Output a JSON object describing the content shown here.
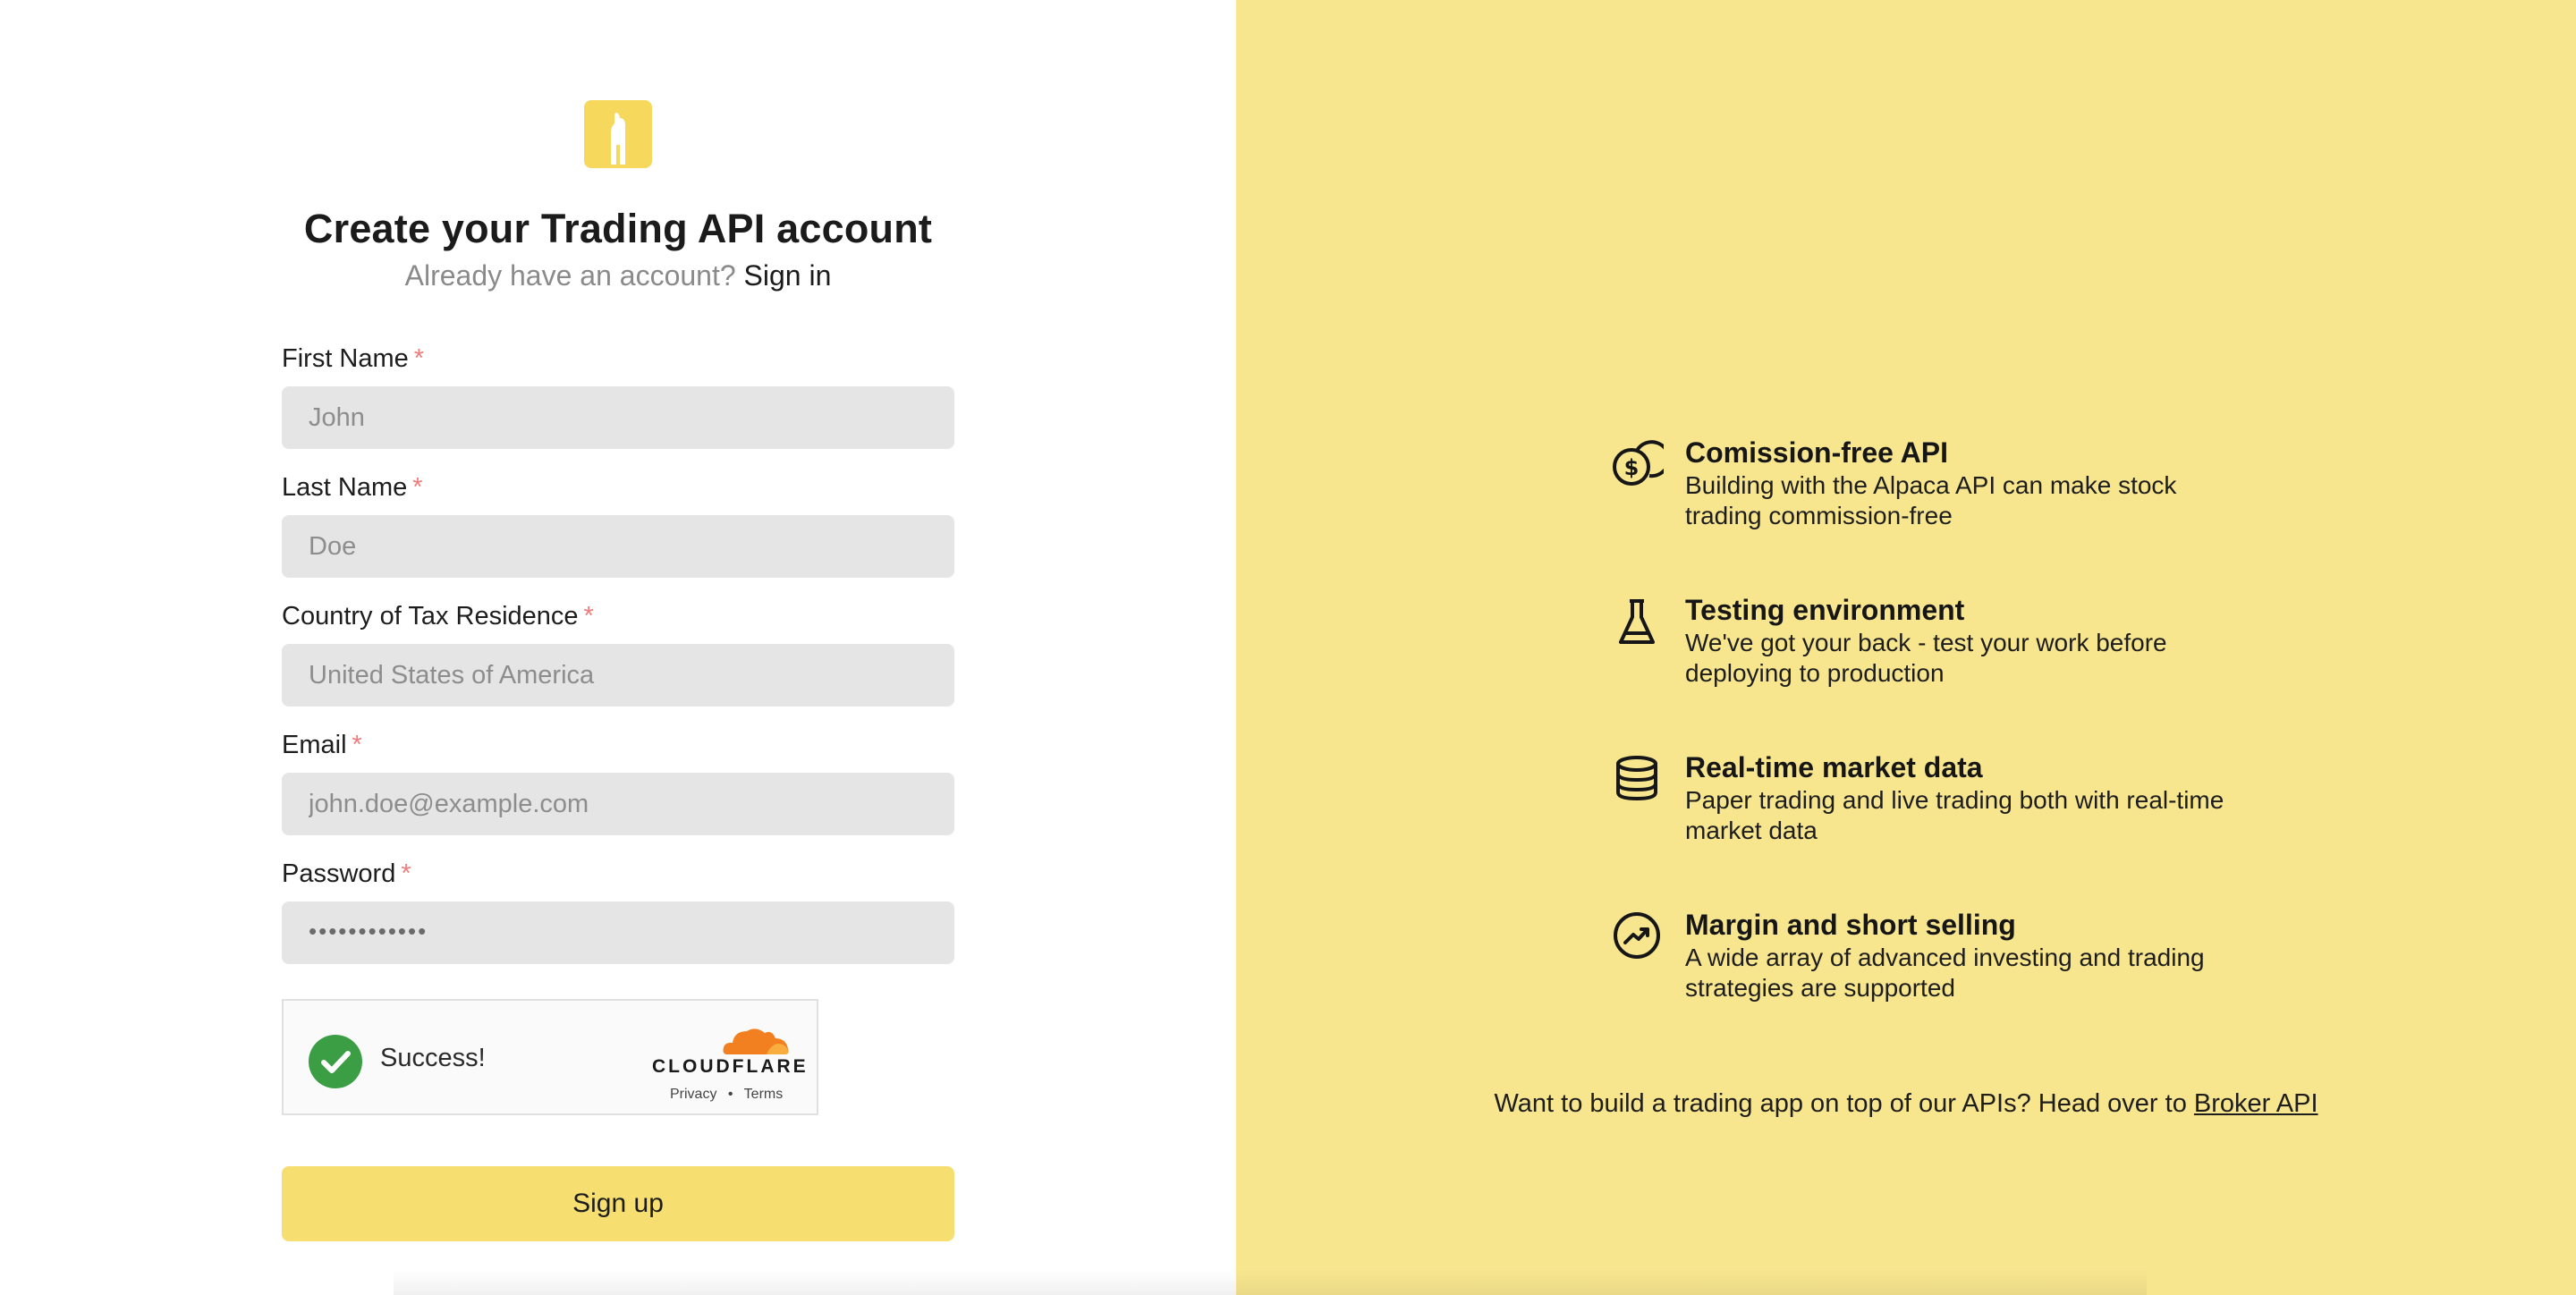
{
  "header": {
    "title": "Create your Trading API account",
    "subtitle_prefix": "Already have an account?",
    "signin_link": "Sign in"
  },
  "form": {
    "required_mark": "*",
    "fields": {
      "first_name": {
        "label": "First Name",
        "placeholder": "John"
      },
      "last_name": {
        "label": "Last Name",
        "placeholder": "Doe"
      },
      "country": {
        "label": "Country of Tax Residence",
        "placeholder": "United States of America"
      },
      "email": {
        "label": "Email",
        "placeholder": "john.doe@example.com"
      },
      "password": {
        "label": "Password",
        "masked_value": "••••••••••••"
      }
    },
    "captcha": {
      "status_text": "Success!",
      "brand": "CLOUDFLARE",
      "privacy": "Privacy",
      "separator": "•",
      "terms": "Terms"
    },
    "submit_label": "Sign up"
  },
  "features": [
    {
      "icon": "coins-icon",
      "title": "Comission-free API",
      "description": "Building with the Alpaca API can make stock trading commission-free"
    },
    {
      "icon": "flask-icon",
      "title": "Testing environment",
      "description": "We've got your back - test your work before deploying to production"
    },
    {
      "icon": "database-icon",
      "title": "Real-time market data",
      "description": "Paper trading and live trading both with real-time market data"
    },
    {
      "icon": "trending-up-icon",
      "title": "Margin and short selling",
      "description": "A wide array of advanced investing and trading strategies are supported"
    }
  ],
  "broker": {
    "text": "Want to build a trading app on top of our APIs? Head over to",
    "link": "Broker API"
  },
  "colors": {
    "brand_yellow": "#f6d85c",
    "right_panel": "#f8e68f",
    "button": "#f6df70",
    "required": "#f07b7b",
    "success_green": "#3b9e45",
    "cloudflare_orange": "#f38020"
  }
}
